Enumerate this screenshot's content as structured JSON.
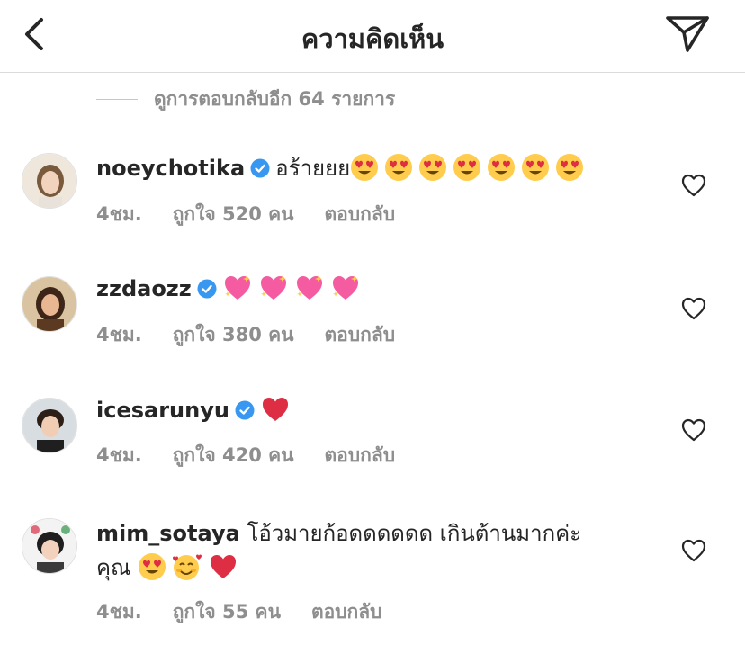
{
  "header": {
    "title": "ความคิดเห็น",
    "back_icon": "chevron-left-icon",
    "send_icon": "paper-plane-icon"
  },
  "more_replies": {
    "label": "ดูการตอบกลับอีก 64 รายการ"
  },
  "comments": [
    {
      "username": "noeychotika",
      "verified": true,
      "text": "อร้ายยย",
      "emojis": [
        "heart-eyes",
        "heart-eyes",
        "heart-eyes",
        "heart-eyes",
        "heart-eyes",
        "heart-eyes",
        "heart-eyes"
      ],
      "time": "4ชม.",
      "likes": "ถูกใจ 520 คน",
      "reply": "ตอบกลับ"
    },
    {
      "username": "zzdaozz",
      "verified": true,
      "text": "",
      "emojis": [
        "sparkling-heart",
        "sparkling-heart",
        "sparkling-heart",
        "sparkling-heart"
      ],
      "time": "4ชม.",
      "likes": "ถูกใจ 380 คน",
      "reply": "ตอบกลับ"
    },
    {
      "username": "icesarunyu",
      "verified": true,
      "text": "",
      "emojis": [
        "red-heart"
      ],
      "time": "4ชม.",
      "likes": "ถูกใจ 420 คน",
      "reply": "ตอบกลับ"
    },
    {
      "username": "mim_sotaya",
      "verified": false,
      "text": "โอ้วมายก้อดดดดดด เกินต้านมากค่ะ",
      "text_line2": "คุณ",
      "emojis": [
        "heart-eyes",
        "smiling-hearts",
        "red-heart"
      ],
      "time": "4ชม.",
      "likes": "ถูกใจ 55 คน",
      "reply": "ตอบกลับ"
    }
  ],
  "colors": {
    "text": "#262626",
    "secondary": "#8e8e8e",
    "verified": "#3897f0",
    "divider": "#dbdbdb"
  }
}
